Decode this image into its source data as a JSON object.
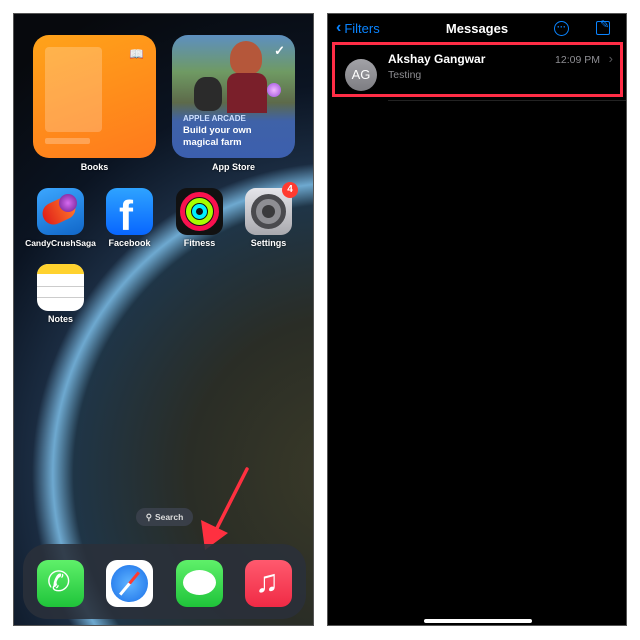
{
  "home": {
    "widgets": [
      {
        "name": "Books",
        "label": "Books"
      },
      {
        "name": "App Store",
        "label": "App Store",
        "kicker": "APPLE ARCADE",
        "headline_line1": "Build your own",
        "headline_line2": "magical farm"
      }
    ],
    "apps": [
      {
        "label": "CandyCrushSaga"
      },
      {
        "label": "Facebook"
      },
      {
        "label": "Fitness"
      },
      {
        "label": "Settings",
        "badge": "4"
      },
      {
        "label": "Notes"
      }
    ],
    "search_label": "Search",
    "dock": [
      "Phone",
      "Safari",
      "Messages",
      "Music"
    ],
    "arrow_color": "#ff3040"
  },
  "messages": {
    "back_label": "Filters",
    "title": "Messages",
    "accent": "#0a84ff",
    "highlight_color": "#ff2d46",
    "conversations": [
      {
        "initials": "AG",
        "name": "Akshay Gangwar",
        "preview": "Testing",
        "time": "12:09 PM"
      }
    ]
  }
}
